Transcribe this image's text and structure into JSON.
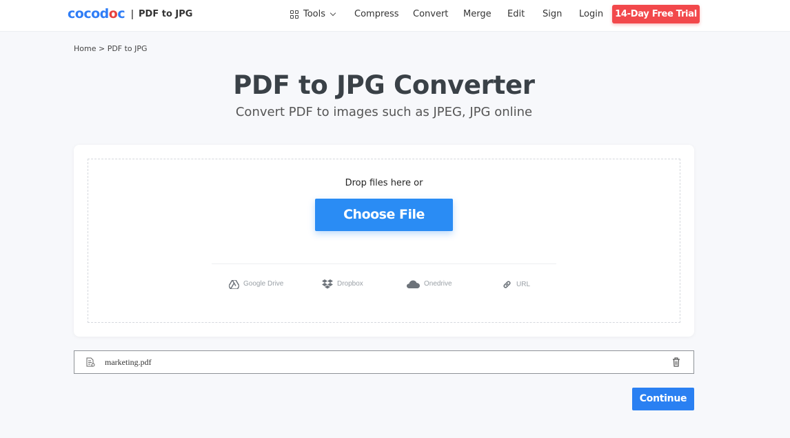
{
  "header": {
    "logo": [
      "co",
      "co",
      "d",
      "o",
      "c"
    ],
    "separator": "|",
    "subtitle": "PDF to JPG",
    "nav": {
      "tools": "Tools",
      "compress": "Compress",
      "convert": "Convert",
      "merge": "Merge",
      "edit": "Edit",
      "sign": "Sign",
      "login": "Login"
    },
    "trial_button": "14-Day Free Trial"
  },
  "breadcrumb": "Home > PDF to JPG",
  "main": {
    "title": "PDF to JPG Converter",
    "subtitle": "Convert PDF to images such as JPEG, JPG online"
  },
  "upload": {
    "drop_text": "Drop files here or",
    "choose_button": "Choose File",
    "sources": [
      {
        "label": "Google Drive",
        "icon": "google-drive-icon"
      },
      {
        "label": "Dropbox",
        "icon": "dropbox-icon"
      },
      {
        "label": "Onedrive",
        "icon": "onedrive-icon"
      },
      {
        "label": "URL",
        "icon": "link-icon"
      }
    ]
  },
  "file": {
    "name": "marketing.pdf"
  },
  "continue_button": "Continue",
  "colors": {
    "brand_blue": "#2a8cf4",
    "trial_red": "#f2484b",
    "background": "#f7f8fb"
  }
}
